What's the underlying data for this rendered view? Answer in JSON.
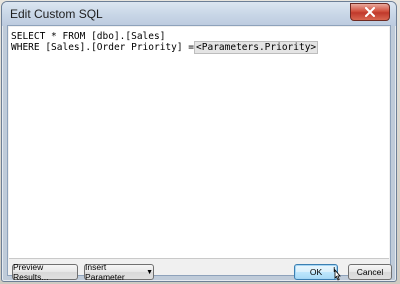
{
  "window": {
    "title": "Edit Custom SQL"
  },
  "editor": {
    "line1": "SELECT * FROM [dbo].[Sales]",
    "line2_prefix": "WHERE [Sales].[Order Priority] =",
    "line2_param": "<Parameters.Priority>"
  },
  "buttons": {
    "preview": "Preview Results...",
    "insert_param": "Insert Parameter",
    "ok": "OK",
    "cancel": "Cancel"
  },
  "icons": {
    "close": "close-icon",
    "dropdown": "chevron-down-icon",
    "cursor": "mouse-cursor-icon"
  },
  "colors": {
    "close_red": "#c0392b",
    "ok_blue": "#a7d9f5"
  }
}
